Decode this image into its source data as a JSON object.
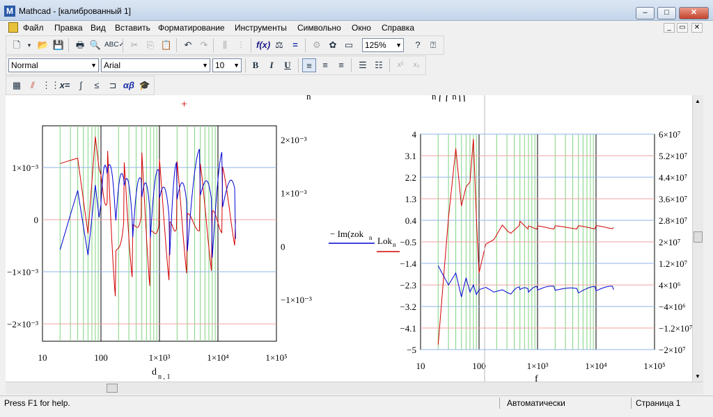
{
  "window": {
    "title": "Mathcad - [калиброванный 1]",
    "logo": "M",
    "minimize_glyph": "–",
    "maximize_glyph": "□",
    "close_glyph": "✕"
  },
  "menu": [
    "Файл",
    "Правка",
    "Вид",
    "Вставить",
    "Форматирование",
    "Инструменты",
    "Символьно",
    "Окно",
    "Справка"
  ],
  "mdi": {
    "minimize_glyph": "_",
    "restore_glyph": "▭",
    "close_glyph": "✕"
  },
  "toolbar": {
    "zoom": "125%",
    "icons": [
      "new-icon",
      "open-icon",
      "save-icon",
      "print-icon",
      "print-preview-icon",
      "spellcheck-icon",
      "cut-icon",
      "copy-icon",
      "paste-icon",
      "undo-icon",
      "redo-icon",
      "align-icon",
      "align-down-icon",
      "insert-function-icon",
      "insert-unit-icon",
      "calculate-icon",
      "component-icon",
      "resource-icon",
      "window-icon",
      "help-icon",
      "whats-this-icon"
    ]
  },
  "format_bar": {
    "style": "Normal",
    "font": "Arial",
    "size": "10",
    "bold": "B",
    "italic": "I",
    "underline": "U",
    "superscript": "x²",
    "subscript": "x₂"
  },
  "math_bar": {
    "icons": [
      "calculator-icon",
      "graph-icon",
      "matrix-icon",
      "evaluation-icon",
      "calculus-icon",
      "boolean-icon",
      "programming-icon",
      "greek-icon",
      "symbolic-icon"
    ]
  },
  "worksheet": {
    "partial_expr_1": "n",
    "partial_expr_2": "n ⎛   ⎛   n⎞⎞",
    "crosshair": "+",
    "mid_trace_1": "− Im(zok",
    "mid_trace_1_sub": "n",
    "mid_trace_2": "Lok",
    "mid_trace_2_sub": "n"
  },
  "chart_data": [
    {
      "type": "line",
      "x_scale": "log",
      "xlim": [
        10,
        100000
      ],
      "x_tick_labels": [
        "10",
        "100",
        "1×10³",
        "1×10⁴",
        "1×10⁵"
      ],
      "y_left_tick_labels": [
        "1×10⁻³",
        "0",
        "−1×10⁻³",
        "−2×10⁻³"
      ],
      "y_right_tick_labels": [
        "2×10⁻³",
        "1×10⁻³",
        "0",
        "−1×10⁻³"
      ],
      "xlabel": "d",
      "xlabel_sub": "n , 1",
      "grid": true,
      "series": [
        {
          "color": "#d40000",
          "x": [
            20,
            40,
            60,
            80,
            100,
            130,
            180,
            250,
            350,
            500,
            700,
            1000,
            1500,
            2000,
            3000,
            5000,
            8000,
            12000,
            20000
          ],
          "y": [
            0.0011,
            0.0012,
            -0.0002,
            0.0016,
            0.0007,
            0.0011,
            -0.0008,
            0.0008,
            -0.0004,
            0.0009,
            -0.0006,
            0.0007,
            -0.0005,
            0.0006,
            -0.0004,
            0.0005,
            -0.0004,
            0.0004,
            5e-05
          ]
        },
        {
          "color": "#0000d4",
          "x": [
            20,
            40,
            60,
            80,
            100,
            130,
            180,
            250,
            350,
            500,
            700,
            1000,
            1500,
            2000,
            3000,
            5000,
            8000,
            12000,
            20000
          ],
          "y": [
            -0.0005,
            0.0006,
            -0.0006,
            0.0007,
            -0.0002,
            0.0005,
            -0.0004,
            0.0003,
            -0.0006,
            0.0002,
            -0.0005,
            0.0003,
            -0.0007,
            0.0004,
            -0.0005,
            0.0006,
            -0.0005,
            0.0005,
            -0.0003
          ]
        }
      ]
    },
    {
      "type": "line",
      "x_scale": "log",
      "xlim": [
        10,
        100000
      ],
      "x_tick_labels": [
        "10",
        "100",
        "1×10³",
        "1×10⁴",
        "1×10⁵"
      ],
      "y_left_tick_labels": [
        "4",
        "3.1",
        "2.2",
        "1.3",
        "0.4",
        "−0.5",
        "−1.4",
        "−2.3",
        "−3.2",
        "−4.1",
        "−5"
      ],
      "y_right_tick_labels": [
        "6×10⁷",
        "5.2×10⁷",
        "4.4×10⁷",
        "3.6×10⁷",
        "2.8×10⁷",
        "2×10⁷",
        "1.2×10⁷",
        "4×10⁶",
        "−4×10⁶",
        "−1.2×10⁷",
        "−2×10⁷"
      ],
      "xlabel": "f",
      "grid": true,
      "series": [
        {
          "color": "#d40000",
          "x": [
            20,
            30,
            40,
            50,
            60,
            70,
            80,
            90,
            100,
            130,
            180,
            250,
            350,
            500,
            700,
            1000,
            2000,
            5000,
            10000,
            20000
          ],
          "y": [
            -4.8,
            0.5,
            3.4,
            1.0,
            1.8,
            2.0,
            3.8,
            0.5,
            -1.8,
            -0.6,
            -0.4,
            0.2,
            -0.2,
            0.3,
            0.1,
            0.1,
            0.1,
            0.1,
            0.1,
            0.1
          ]
        },
        {
          "color": "#0000d4",
          "x": [
            20,
            30,
            40,
            50,
            60,
            70,
            80,
            90,
            100,
            130,
            180,
            250,
            350,
            500,
            700,
            1000,
            2000,
            5000,
            10000,
            20000
          ],
          "y": [
            -1.5,
            -2.3,
            -1.8,
            -2.8,
            -2.0,
            -2.6,
            -2.3,
            -2.7,
            -2.5,
            -2.4,
            -2.6,
            -2.5,
            -2.7,
            -2.5,
            -2.6,
            -2.5,
            -2.5,
            -2.6,
            -2.5,
            -2.5
          ]
        }
      ]
    }
  ],
  "status": {
    "help": "Press F1 for help.",
    "mode": "Автоматически",
    "page": "Страница 1"
  }
}
